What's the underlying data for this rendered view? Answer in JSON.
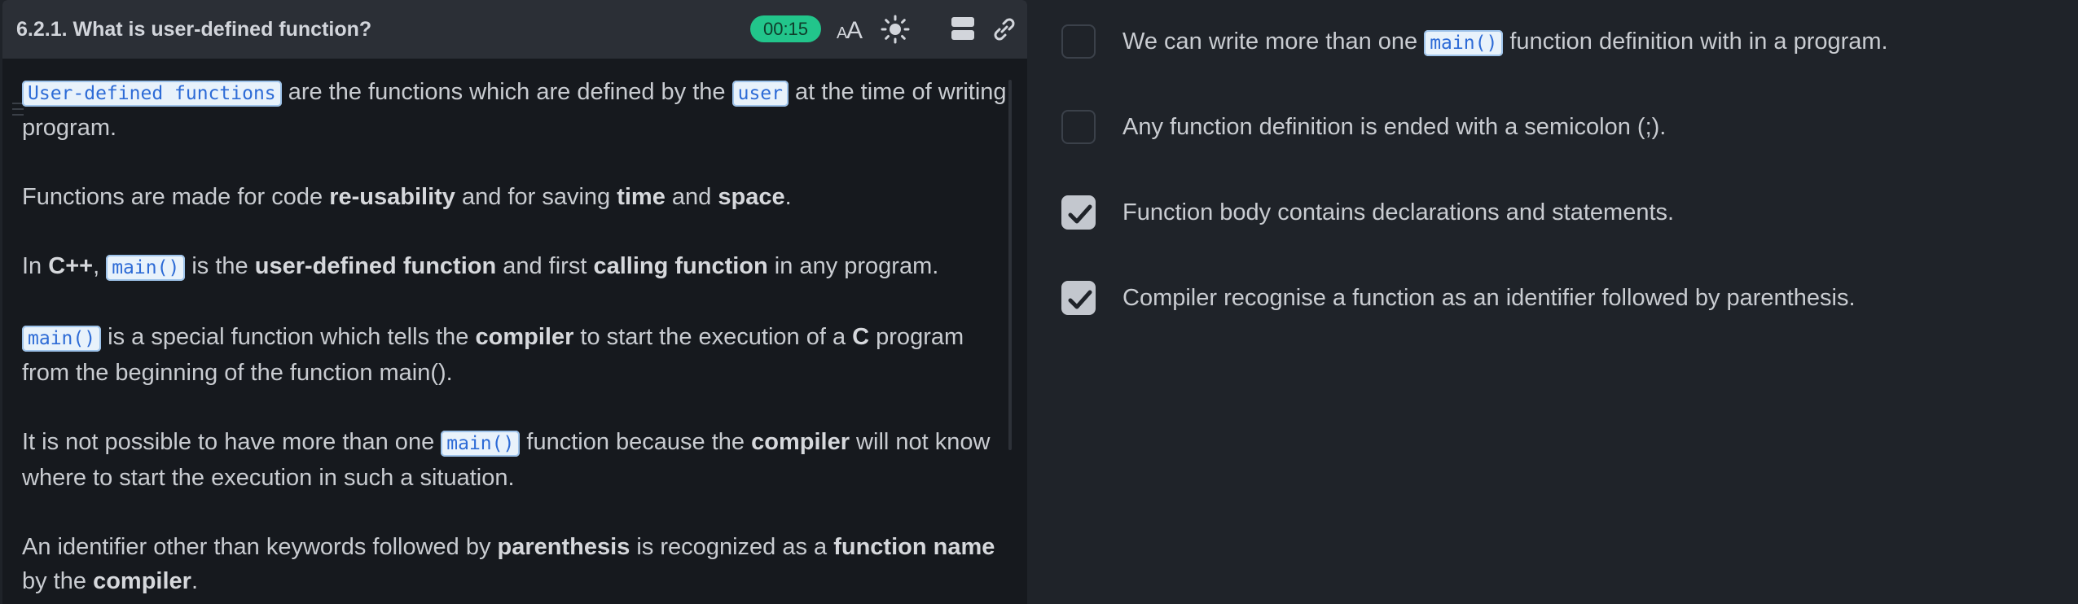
{
  "header": {
    "title": "6.2.1. What is user-defined function?",
    "timer": "00:15",
    "font_icon_label": "AA"
  },
  "content": {
    "p1": {
      "code1": "User-defined functions",
      "t1": " are the functions which are defined by the ",
      "code2": "user",
      "t2": " at the time of writing program."
    },
    "p2": {
      "t1": "Functions are made for code ",
      "b1": "re-usability",
      "t2": " and for saving ",
      "b2": "time",
      "t3": " and ",
      "b3": "space",
      "t4": "."
    },
    "p3": {
      "t1": "In ",
      "b1": "C++",
      "t2": ", ",
      "code1": "main()",
      "t3": " is the ",
      "b2": "user-defined function",
      "t4": " and first ",
      "b3": "calling function",
      "t5": " in any program."
    },
    "p4": {
      "code1": "main()",
      "t1": " is a special function which tells the ",
      "b1": "compiler",
      "t2": " to start the execution of a ",
      "b2": "C",
      "t3": " program from the beginning of the function main()."
    },
    "p5": {
      "t1": "It is not possible to have more than one ",
      "code1": "main()",
      "t2": " function because the ",
      "b1": "compiler",
      "t3": " will not know where to start the execution in such a situation."
    },
    "p6": {
      "t1": "An identifier other than keywords followed by ",
      "b1": "parenthesis",
      "t2": " is recognized as a ",
      "b2": "function name",
      "t3": " by the ",
      "b3": "compiler",
      "t4": "."
    }
  },
  "options": [
    {
      "pre": "We can write more than one ",
      "code": "main()",
      "post": " function definition with in a program.",
      "checked": false
    },
    {
      "text": "Any function definition is ended with a semicolon (;).",
      "checked": false
    },
    {
      "text": "Function body contains declarations and statements.",
      "checked": true
    },
    {
      "text": "Compiler recognise a function as an identifier followed by parenthesis.",
      "checked": true
    }
  ],
  "colors": {
    "timer_bg": "#22c58b",
    "code_bg": "#e8f2fb",
    "code_text": "#2d6bd6",
    "checked_bg": "#c3c7ce"
  }
}
